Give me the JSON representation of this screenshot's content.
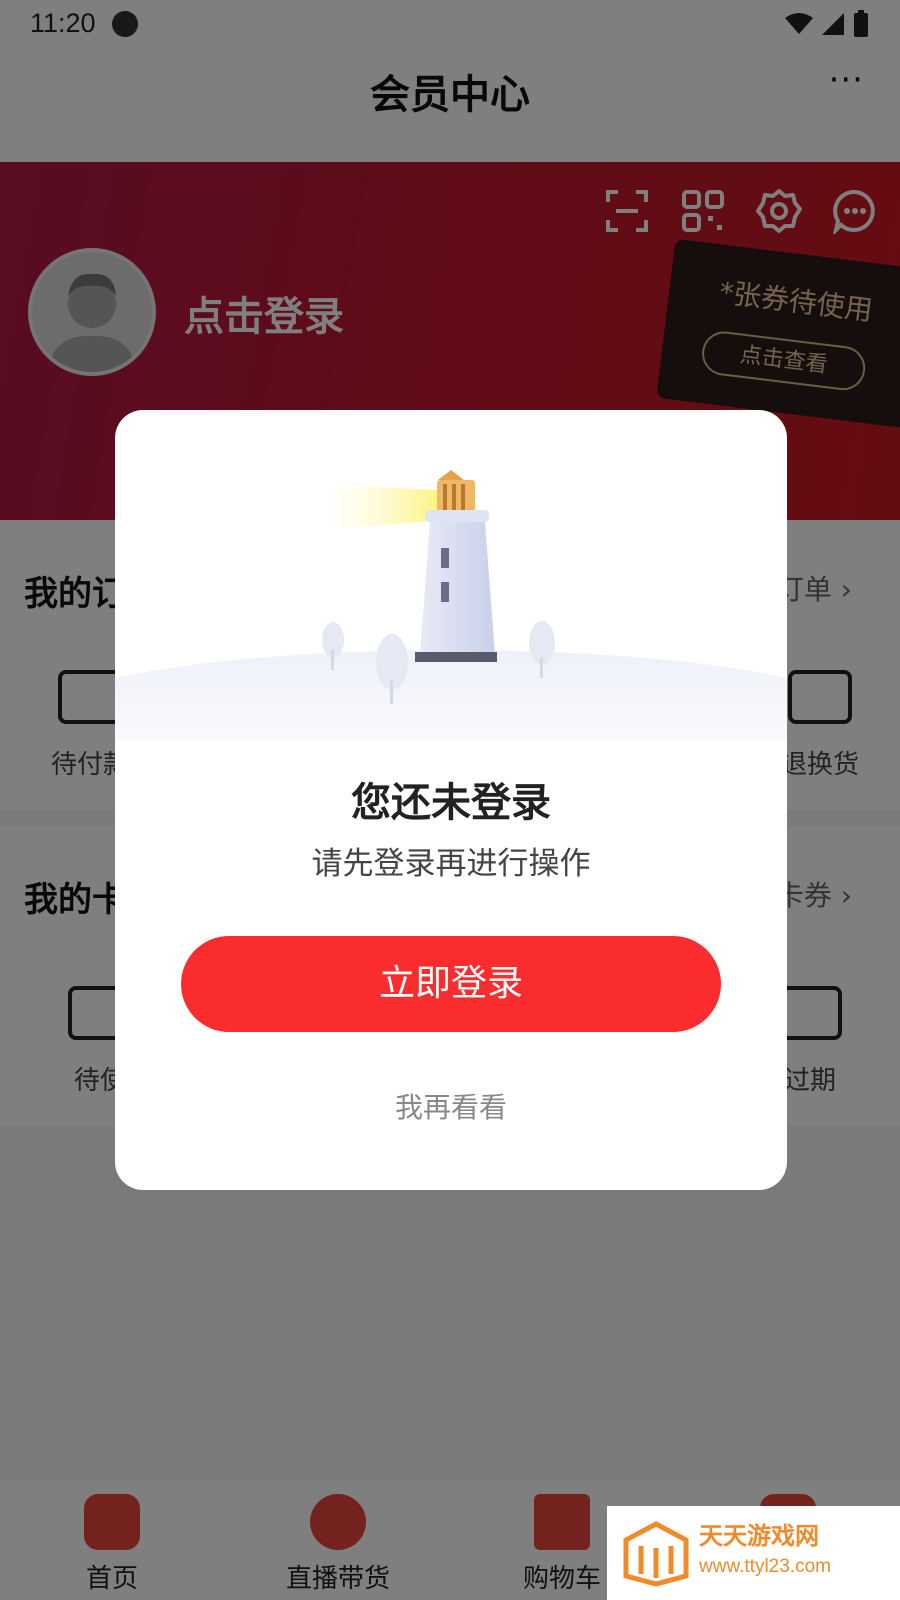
{
  "status_bar": {
    "time": "11:20"
  },
  "nav": {
    "title": "会员中心",
    "more": "···"
  },
  "header": {
    "login_text": "点击登录",
    "coupon_text": "*张券待使用",
    "coupon_button": "点击查看"
  },
  "orders": {
    "title": "我的订",
    "more": "订单",
    "items": [
      {
        "label": "待付款"
      },
      {
        "label": "退换货"
      }
    ]
  },
  "cards": {
    "title": "我的卡",
    "more": "卡券",
    "items": [
      {
        "label": "待使"
      },
      {
        "label": "过期"
      }
    ]
  },
  "tabs": [
    {
      "label": "首页"
    },
    {
      "label": "直播带货"
    },
    {
      "label": "购物车"
    }
  ],
  "modal": {
    "title": "您还未登录",
    "subtitle": "请先登录再进行操作",
    "primary_button": "立即登录",
    "secondary_button": "我再看看"
  },
  "watermark": {
    "name": "天天游戏网",
    "url": "www.ttyl23.com"
  },
  "colors": {
    "accent": "#fa2c2e",
    "header_red": "#c01630",
    "watermark_orange": "#f08a2a"
  }
}
